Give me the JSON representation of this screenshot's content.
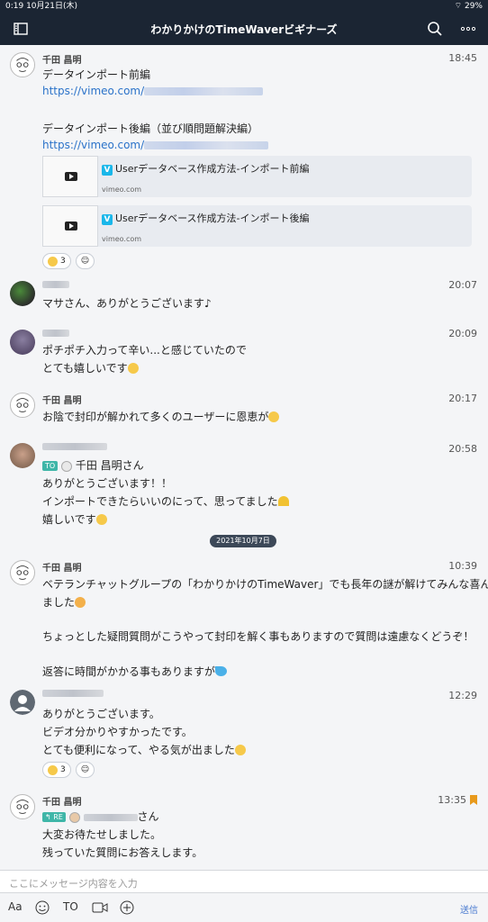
{
  "status_bar": {
    "time_date": "0:19  10月21日(木)",
    "battery": "29%"
  },
  "header": {
    "title": "わかりかけのTimeWaverビギナーズ",
    "left_icon": "sidebar-icon",
    "right_icons": [
      "search-icon",
      "more-icon"
    ]
  },
  "messages": [
    {
      "name": "千田 昌明",
      "time": "18:45",
      "lines": [
        "データインポート前編",
        "https://vimeo.com/",
        "",
        "データインポート後編（並び順問題解決編）",
        "https://vimeo.com/"
      ],
      "previews": [
        {
          "title": "Userデータベース作成方法-インポート前編",
          "site": "vimeo.com"
        },
        {
          "title": "Userデータベース作成方法-インポート後編",
          "site": "vimeo.com"
        }
      ],
      "reaction_count": "3"
    },
    {
      "time": "20:07",
      "lines": [
        "マサさん、ありがとうございます♪"
      ]
    },
    {
      "time": "20:09",
      "lines": [
        "ポチポチ入力って辛い...と感じていたので",
        "とても嬉しいです"
      ]
    },
    {
      "name": "千田 昌明",
      "time": "20:17",
      "lines": [
        "お陰で封印が解かれて多くのユーザーに恩恵が"
      ]
    },
    {
      "time": "20:58",
      "to_label": "TO",
      "to_name": "千田 昌明さん",
      "lines": [
        "ありがとうございます！！",
        "インポートできたらいいのにって、思ってました",
        "嬉しいです"
      ]
    },
    {
      "date_divider": "2021年10月7日"
    },
    {
      "name": "千田 昌明",
      "time": "10:39",
      "lines": [
        "ベテランチャットグループの「わかりかけのTimeWaver」でも長年の謎が解けてみんな喜んで",
        "ました",
        "",
        "ちょっとした疑問質問がこうやって封印を解く事もありますので質問は遠慮なくどうぞ！",
        "",
        "返答に時間がかかる事もありますが"
      ]
    },
    {
      "time": "12:29",
      "lines": [
        "ありがとうございます。",
        "ビデオ分かりやすかったです。",
        "とても便利になって、やる気が出ました"
      ],
      "reaction_count": "3"
    },
    {
      "name": "千田 昌明",
      "time": "13:35",
      "re_label": "RE",
      "re_suffix": "さん",
      "lines": [
        "大変お待たせしました。",
        "残っていた質問にお答えします。"
      ]
    }
  ],
  "composer": {
    "placeholder": "ここにメッセージ内容を入力"
  },
  "toolbar": {
    "font": "Aa",
    "to": "TO",
    "send": "送信"
  }
}
